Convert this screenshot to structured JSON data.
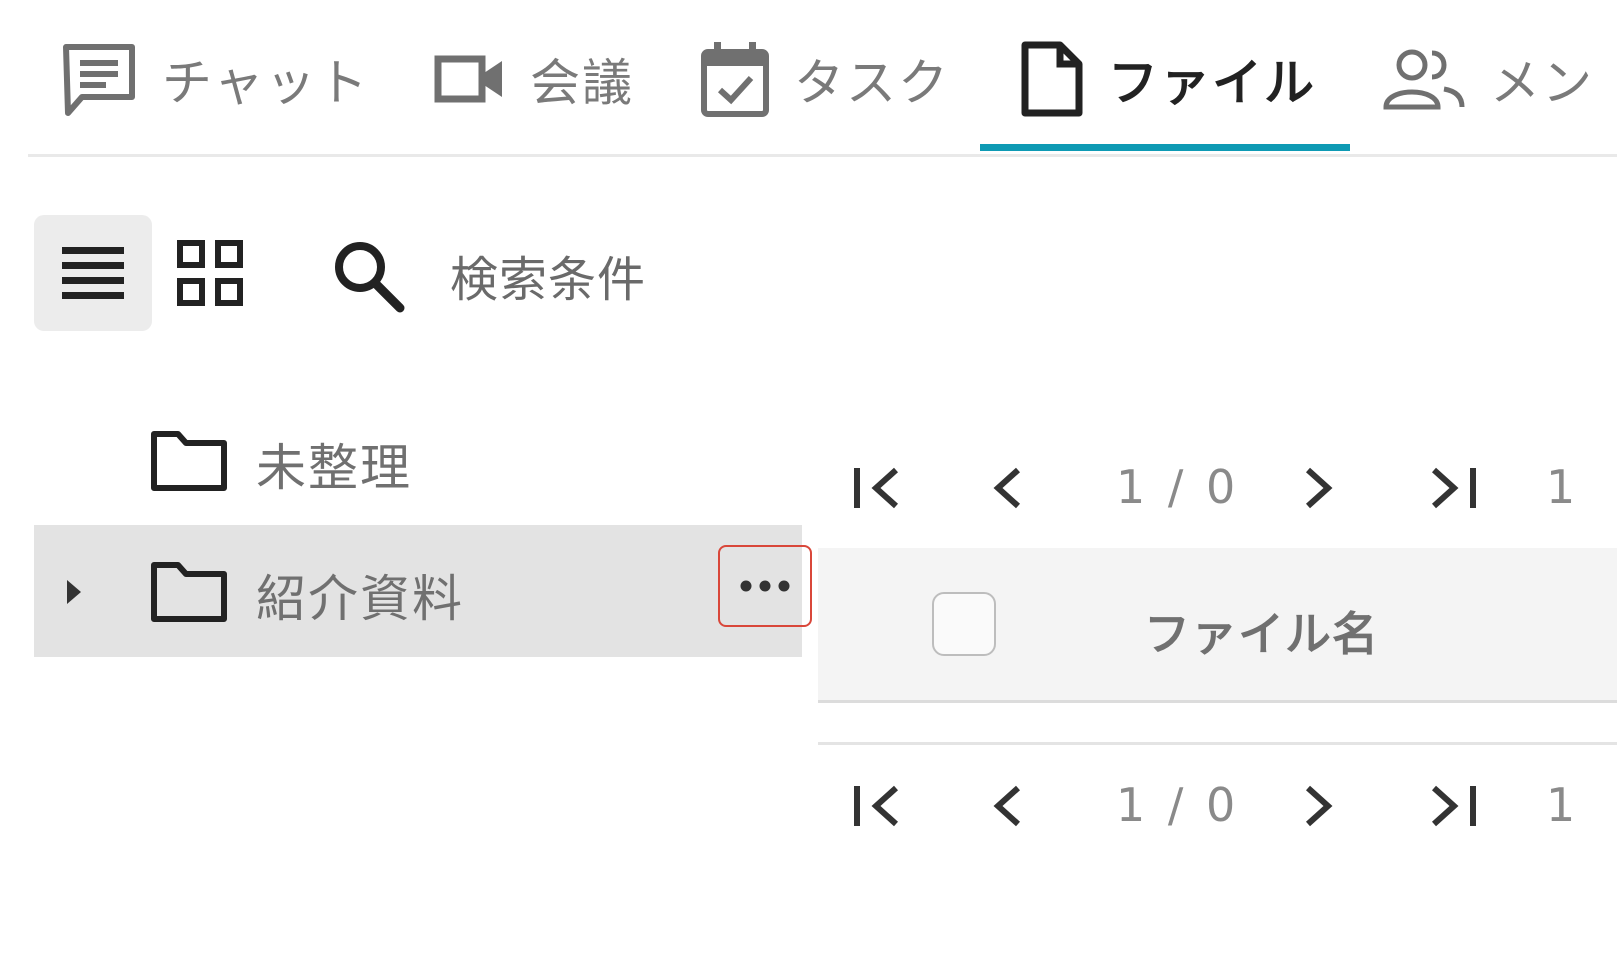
{
  "tabs": [
    {
      "label": "チャット",
      "icon": "chat-icon",
      "active": false
    },
    {
      "label": "会議",
      "icon": "video-icon",
      "active": false
    },
    {
      "label": "タスク",
      "icon": "calendar-check-icon",
      "active": false
    },
    {
      "label": "ファイル",
      "icon": "file-icon",
      "active": true
    },
    {
      "label": "メン",
      "icon": "members-icon",
      "active": false
    }
  ],
  "toolbar": {
    "list_view_icon": "list-view-icon",
    "grid_view_icon": "grid-view-icon",
    "search_label": "検索条件"
  },
  "folders": [
    {
      "label": "未整理",
      "icon": "folder-icon",
      "expandable": false,
      "selected": false
    },
    {
      "label": "紹介資料",
      "icon": "folder-icon",
      "expandable": true,
      "selected": true
    }
  ],
  "pagination_top": {
    "page_info": "1 / 0",
    "page_size": "1"
  },
  "table": {
    "columns": [
      "ファイル名"
    ],
    "rows": []
  },
  "pagination_bottom": {
    "page_info": "1 / 0",
    "page_size": "1"
  },
  "colors": {
    "accent": "#0e9ab4",
    "highlight_border": "#d9473a",
    "selected_row": "#e3e3e3"
  }
}
